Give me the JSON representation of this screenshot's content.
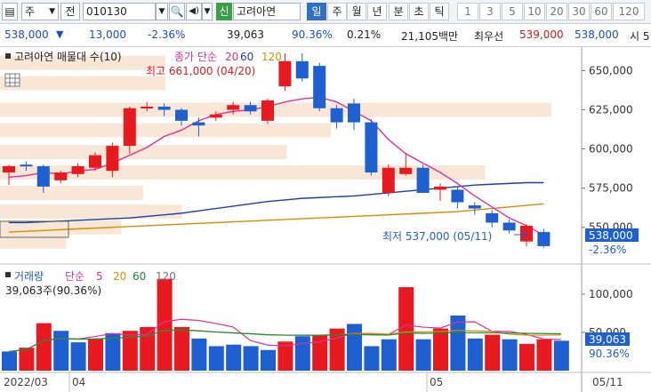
{
  "toolbar": {
    "market": "주",
    "type": "전",
    "code": "010130",
    "sin_badge": "신",
    "name": "고려아연",
    "periods": [
      "일",
      "주",
      "월",
      "년",
      "분",
      "초",
      "틱"
    ],
    "active_period": "일",
    "intervals": [
      "1",
      "3",
      "5",
      "10",
      "20",
      "30",
      "60",
      "120"
    ]
  },
  "info": {
    "price": "538,000",
    "change": "13,000",
    "change_pct": "-2.36%",
    "volume": "39,063",
    "vol_ratio": "90.36%",
    "turnover": "0.21%",
    "amount": "21,105백만",
    "quote_label": "최우선",
    "ask": "539,000",
    "bid": "538,000",
    "last_label": "시 5"
  },
  "colors": {
    "up": "#e8191f",
    "down": "#1e5fd1",
    "ma5": "#e0309a",
    "ma20": "#d98c00",
    "ma60": "#1f3fa8",
    "ma120": "#888888"
  },
  "price_panel": {
    "title": "고려아연 매물대 수(10)",
    "ma_label": "종가 단순",
    "ma_periods": [
      "20",
      "60",
      "120"
    ],
    "high_label": "최고 661,000 (04/20)",
    "low_label": "최저 537,000 (05/11)",
    "y_ticks": [
      "650,000",
      "625,000",
      "600,000",
      "575,000",
      "550,000"
    ],
    "current_price": "538,000",
    "current_pct": "-2.36%"
  },
  "volume_panel": {
    "title": "거래량",
    "ma_label": "단순",
    "ma_periods": [
      "5",
      "20",
      "60",
      "120"
    ],
    "current_label": "39,063주(90.36%)",
    "y_ticks": [
      "100,000",
      "50,000"
    ],
    "current_volume": "39,063",
    "current_pct": "90.36%"
  },
  "x_axis": {
    "labels": [
      "2022/03",
      "04",
      "05"
    ],
    "right_label": "05/11"
  },
  "chart_data": {
    "type": "candlestick",
    "ylim": [
      530000,
      665000
    ],
    "candles": [
      {
        "o": 585000,
        "h": 590000,
        "l": 577000,
        "c": 589000
      },
      {
        "o": 590000,
        "h": 592000,
        "l": 586000,
        "c": 589000
      },
      {
        "o": 589000,
        "h": 590000,
        "l": 572000,
        "c": 576000
      },
      {
        "o": 580000,
        "h": 586000,
        "l": 578000,
        "c": 585000
      },
      {
        "o": 584000,
        "h": 591000,
        "l": 582000,
        "c": 589000
      },
      {
        "o": 588000,
        "h": 598000,
        "l": 586000,
        "c": 596000
      },
      {
        "o": 586000,
        "h": 604000,
        "l": 582000,
        "c": 602000
      },
      {
        "o": 602000,
        "h": 627000,
        "l": 597000,
        "c": 626000
      },
      {
        "o": 626000,
        "h": 630000,
        "l": 624000,
        "c": 627000
      },
      {
        "o": 627000,
        "h": 629000,
        "l": 621000,
        "c": 625000
      },
      {
        "o": 625000,
        "h": 626000,
        "l": 615000,
        "c": 618000
      },
      {
        "o": 617000,
        "h": 620000,
        "l": 608000,
        "c": 615000
      },
      {
        "o": 620000,
        "h": 624000,
        "l": 618000,
        "c": 622000
      },
      {
        "o": 625000,
        "h": 630000,
        "l": 622000,
        "c": 628000
      },
      {
        "o": 628000,
        "h": 630000,
        "l": 622000,
        "c": 624000
      },
      {
        "o": 618000,
        "h": 632000,
        "l": 616000,
        "c": 631000
      },
      {
        "o": 640000,
        "h": 661000,
        "l": 637000,
        "c": 656000
      },
      {
        "o": 656000,
        "h": 661000,
        "l": 643000,
        "c": 645000
      },
      {
        "o": 653000,
        "h": 655000,
        "l": 624000,
        "c": 626000
      },
      {
        "o": 626000,
        "h": 628000,
        "l": 613000,
        "c": 617000
      },
      {
        "o": 629000,
        "h": 632000,
        "l": 612000,
        "c": 617000
      },
      {
        "o": 617000,
        "h": 619000,
        "l": 583000,
        "c": 585000
      },
      {
        "o": 572000,
        "h": 590000,
        "l": 570000,
        "c": 588000
      },
      {
        "o": 584000,
        "h": 597000,
        "l": 583000,
        "c": 588000
      },
      {
        "o": 588000,
        "h": 590000,
        "l": 574000,
        "c": 572000
      },
      {
        "o": 574000,
        "h": 578000,
        "l": 567000,
        "c": 576000
      },
      {
        "o": 574000,
        "h": 576000,
        "l": 562000,
        "c": 566000
      },
      {
        "o": 564000,
        "h": 566000,
        "l": 558000,
        "c": 562000
      },
      {
        "o": 559000,
        "h": 561000,
        "l": 550000,
        "c": 553000
      },
      {
        "o": 553000,
        "h": 555000,
        "l": 546000,
        "c": 548000
      },
      {
        "o": 541000,
        "h": 552000,
        "l": 538000,
        "c": 551000
      },
      {
        "o": 547000,
        "h": 549000,
        "l": 537000,
        "c": 538000
      }
    ],
    "volume": {
      "ylim": [
        0,
        130000
      ],
      "values": [
        25000,
        30000,
        62000,
        52000,
        37000,
        42000,
        49000,
        52000,
        57000,
        120000,
        57000,
        42000,
        32000,
        34000,
        32000,
        27000,
        38000,
        45000,
        47000,
        55000,
        61000,
        32000,
        41000,
        109000,
        41000,
        55000,
        72000,
        42000,
        47000,
        41000,
        35000,
        41000,
        39063
      ],
      "colors": [
        "down",
        "up",
        "up",
        "down",
        "down",
        "up",
        "down",
        "up",
        "up",
        "up",
        "up",
        "down",
        "down",
        "down",
        "down",
        "down",
        "up",
        "down",
        "up",
        "up",
        "down",
        "down",
        "down",
        "up",
        "down",
        "up",
        "down",
        "down",
        "up",
        "down",
        "up",
        "up",
        "down"
      ]
    },
    "ma": {
      "ma5": [
        582000,
        583000,
        585000,
        584000,
        586000,
        587000,
        591000,
        596000,
        601000,
        608000,
        612000,
        618000,
        622000,
        624000,
        625000,
        627000,
        630000,
        632000,
        633000,
        630000,
        624000,
        618000,
        606000,
        597000,
        591000,
        585000,
        578000,
        570000,
        563000,
        556000,
        551000,
        545000
      ],
      "ma20": [
        547000,
        547500,
        548000,
        548500,
        549000,
        549500,
        550000,
        550500,
        551000,
        551500,
        552000,
        552500,
        553000,
        553500,
        554000,
        554500,
        555000,
        555500,
        556000,
        556500,
        557000,
        557500,
        558000,
        558500,
        559000,
        559500,
        560000,
        561000,
        562000,
        563000,
        564000,
        565000
      ],
      "ma60": [
        553000,
        553000,
        553500,
        554000,
        554500,
        555000,
        555500,
        556000,
        557000,
        558000,
        559000,
        560500,
        562000,
        563500,
        565000,
        566500,
        567500,
        568500,
        569000,
        569500,
        570000,
        571000,
        572000,
        573000,
        574000,
        575000,
        576000,
        577000,
        577500,
        578000,
        578500,
        578500
      ]
    },
    "volume_profile": [
      {
        "price": 655000,
        "width": 0.3
      },
      {
        "price": 642000,
        "width": 0.3
      },
      {
        "price": 625000,
        "width": 1.0
      },
      {
        "price": 612000,
        "width": 0.6
      },
      {
        "price": 598000,
        "width": 0.52
      },
      {
        "price": 585000,
        "width": 0.88
      },
      {
        "price": 572000,
        "width": 0.26
      },
      {
        "price": 560000,
        "width": 0.33
      },
      {
        "price": 550000,
        "width": 0.22
      },
      {
        "price": 541000,
        "width": 0.12
      }
    ]
  }
}
